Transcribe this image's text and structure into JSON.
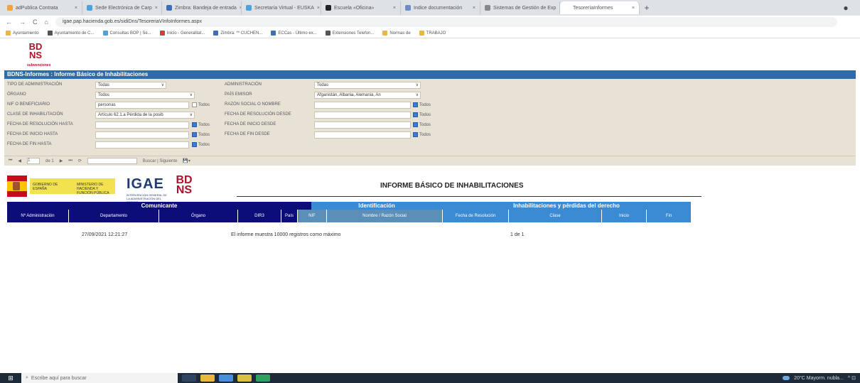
{
  "browser": {
    "tabs": [
      {
        "label": "adPublica Contrata",
        "color": "#f2a33a"
      },
      {
        "label": "Sede Electrónica de Carp",
        "color": "#4aa3df"
      },
      {
        "label": "Zimbra: Bandeja de entrada",
        "color": "#3c6fb6"
      },
      {
        "label": "Secretaría Virtual - EUSKA",
        "color": "#4aa3df"
      },
      {
        "label": "Escuela «Oficina»",
        "color": "#222222"
      },
      {
        "label": "Indice documentación",
        "color": "#6b8fc4"
      },
      {
        "label": "Sistemas de Gestión de Exp",
        "color": "#888888"
      },
      {
        "label": "TesoreríaInformes",
        "color": "#ffffff"
      }
    ],
    "new_tab": "+",
    "account": "●",
    "nav": {
      "back": "←",
      "forward": "→",
      "reload": "C",
      "home": "⌂"
    },
    "url": "igae.pap.hacienda.gob.es/sidiDns/TesoreriaVInfoInformes.aspx",
    "bookmarks": [
      {
        "label": "Ayuntamiento",
        "color": "#e8b93c"
      },
      {
        "label": "Ayuntamiento de C...",
        "color": "#555555"
      },
      {
        "label": "Consultas BOP | Se...",
        "color": "#4aa3df"
      },
      {
        "label": "Inicio - Generalitat...",
        "color": "#d04040"
      },
      {
        "label": "Zimbra: ** CUCHEN...",
        "color": "#3c6fb6"
      },
      {
        "label": "ECCas - Último ex...",
        "color": "#3c6fb6"
      },
      {
        "label": "Extensiones Telefon...",
        "color": "#555555"
      },
      {
        "label": "Normas de",
        "color": "#e8b93c"
      },
      {
        "label": "TRABAJO",
        "color": "#e8b93c"
      }
    ]
  },
  "logo": {
    "text": "BDNS",
    "sub": "subvenciones"
  },
  "page_title": "BDNS-Informes : Informe Básico de Inhabilitaciones",
  "form": {
    "tipo_admin": {
      "label": "TIPO DE ADMINISTRACIÓN",
      "value": "Todas"
    },
    "administracion": {
      "label": "ADMINISTRACIÓN",
      "value": "Todas"
    },
    "organo": {
      "label": "ÓRGANO",
      "value": "Todos"
    },
    "pais_emisor": {
      "label": "PAÍS EMISOR",
      "value": "Afganistán, Albania, Alemania, An"
    },
    "nif": {
      "label": "NIF O BENEFICIARIO",
      "value": "personas",
      "check": "Todos"
    },
    "razon_social": {
      "label": "RAZÓN SOCIAL O NOMBRE",
      "check": "Todos"
    },
    "clase": {
      "label": "CLASE DE INHABILITACIÓN",
      "value": "Artículo 62.1.a Pérdida de la posib"
    },
    "f_resol_desde": {
      "label": "FECHA DE RESOLUCIÓN DESDE",
      "check": "Todos"
    },
    "f_resol_hasta": {
      "label": "FECHA DE RESOLUCIÓN HASTA",
      "check": "Todos"
    },
    "f_inicio_desde": {
      "label": "FECHA DE INICIO DESDE",
      "check": "Todos"
    },
    "f_inicio_hasta": {
      "label": "FECHA DE INICIO HASTA",
      "check": "Todos"
    },
    "f_fin_desde": {
      "label": "FECHA DE FIN DESDE",
      "check": "Todos"
    },
    "f_fin_hasta": {
      "label": "FECHA DE FIN HASTA",
      "check": "Todos"
    },
    "dropdown_arrow": "∨"
  },
  "report_toolbar": {
    "first": "⏮",
    "prev": "◀",
    "page": "1",
    "of": "de 1",
    "next": "▶",
    "last": "⏭",
    "refresh": "⟳",
    "find": "Buscar | Siguiente",
    "export": "💾▾"
  },
  "report": {
    "title": "INFORME BÁSICO DE INHABILITACIONES",
    "ministry1": "GOBIERNO DE ESPAÑA",
    "ministry2": "MINISTERIO DE HACIENDA Y FUNCIÓN PÚBLICA",
    "igae": "IGAE",
    "igae_sub": "INTERVENCIÓN GENERAL DE LA ADMINISTRACIÓN DEL ESTADO",
    "bdns": "BDNS",
    "groups": {
      "comunicante": "Comunicante",
      "identificacion": "Identificación",
      "inhabilitaciones": "Inhabilitaciones y pérdidas del derecho"
    },
    "columns": [
      "Nº Administración",
      "Departamento",
      "Órgano",
      "DIR3",
      "País",
      "NIF",
      "Nombre / Razón Social",
      "Fecha de Resolución",
      "Clase",
      "Inicio",
      "Fin"
    ],
    "footer": {
      "timestamp": "27/09/2021 12:21:27",
      "message": "El informe muestra 10000 registros como máximo",
      "page": "1 de 1"
    }
  },
  "taskbar": {
    "search_placeholder": "Escribe aquí para buscar",
    "weather": "20°C Mayorm. nubla...",
    "win": "⊞",
    "search_icon": "⌕",
    "tray_icons": "^ ⊡"
  },
  "colors": {
    "titlebar": "#2f6ba8",
    "comunicante": "#0d0d7a",
    "identificacion": "#3a8ad4",
    "identificacion_sub": "#5b8fb8",
    "inhabilitaciones": "#3a8ad4",
    "bdns_red": "#b0102a"
  }
}
